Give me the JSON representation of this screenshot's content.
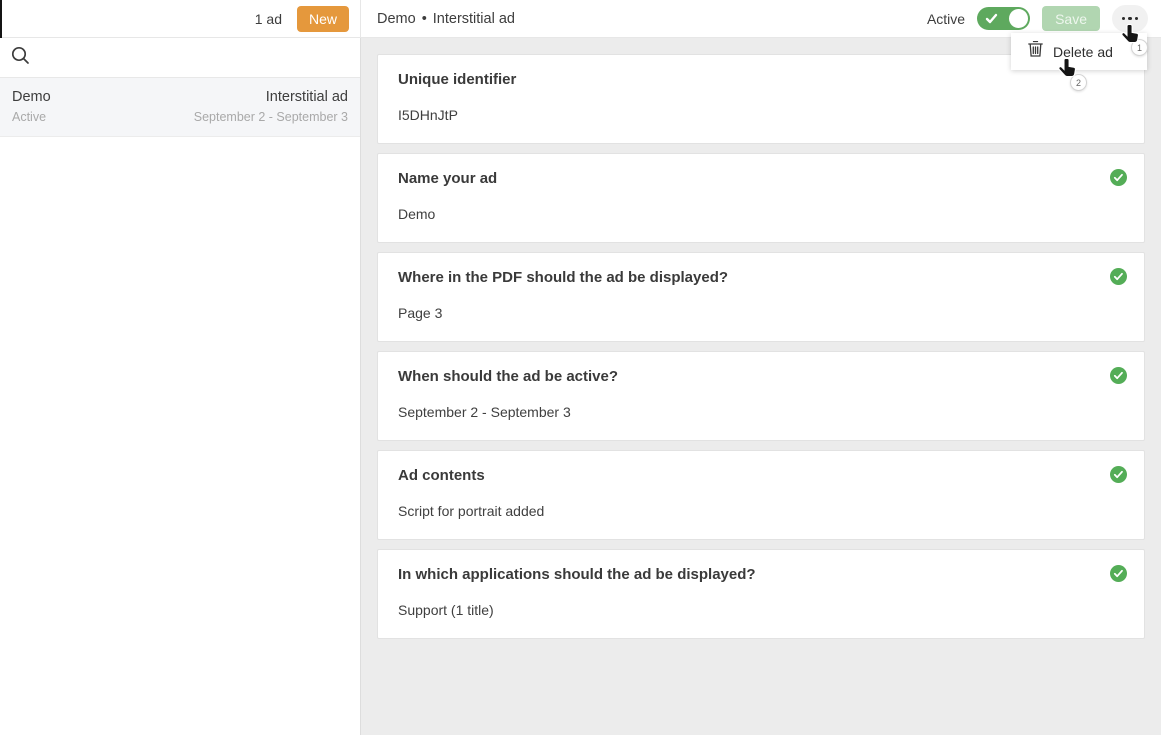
{
  "topbar": {
    "ad_count": "1 ad",
    "new_button": "New",
    "title_name": "Demo",
    "title_separator": "•",
    "title_type": "Interstitial ad",
    "active_label": "Active",
    "save_button": "Save",
    "more_icon": "more-options"
  },
  "sidebar": {
    "search_icon": "search",
    "item": {
      "name": "Demo",
      "status": "Active",
      "type": "Interstitial ad",
      "dates": "September 2 - September 3"
    }
  },
  "menu": {
    "delete_label": "Delete ad",
    "delete_icon": "trash"
  },
  "annotations": {
    "step1": "1",
    "step2": "2"
  },
  "cards": [
    {
      "title": "Unique identifier",
      "value": "I5DHnJtP",
      "checked": false
    },
    {
      "title": "Name your ad",
      "value": "Demo",
      "checked": true
    },
    {
      "title": "Where in the PDF should the ad be displayed?",
      "value": "Page 3",
      "checked": true
    },
    {
      "title": "When should the ad be active?",
      "value": "September 2 - September 3",
      "checked": true
    },
    {
      "title": "Ad contents",
      "value": "Script for portrait added",
      "checked": true
    },
    {
      "title": "In which applications should the ad be displayed?",
      "value": "Support (1 title)",
      "checked": true
    }
  ],
  "colors": {
    "accent_orange": "#E5983C",
    "toggle_green": "#5EA95E",
    "save_disabled_bg": "#B1D6B1",
    "check_green": "#54AD57",
    "main_bg": "#ECECEC"
  }
}
